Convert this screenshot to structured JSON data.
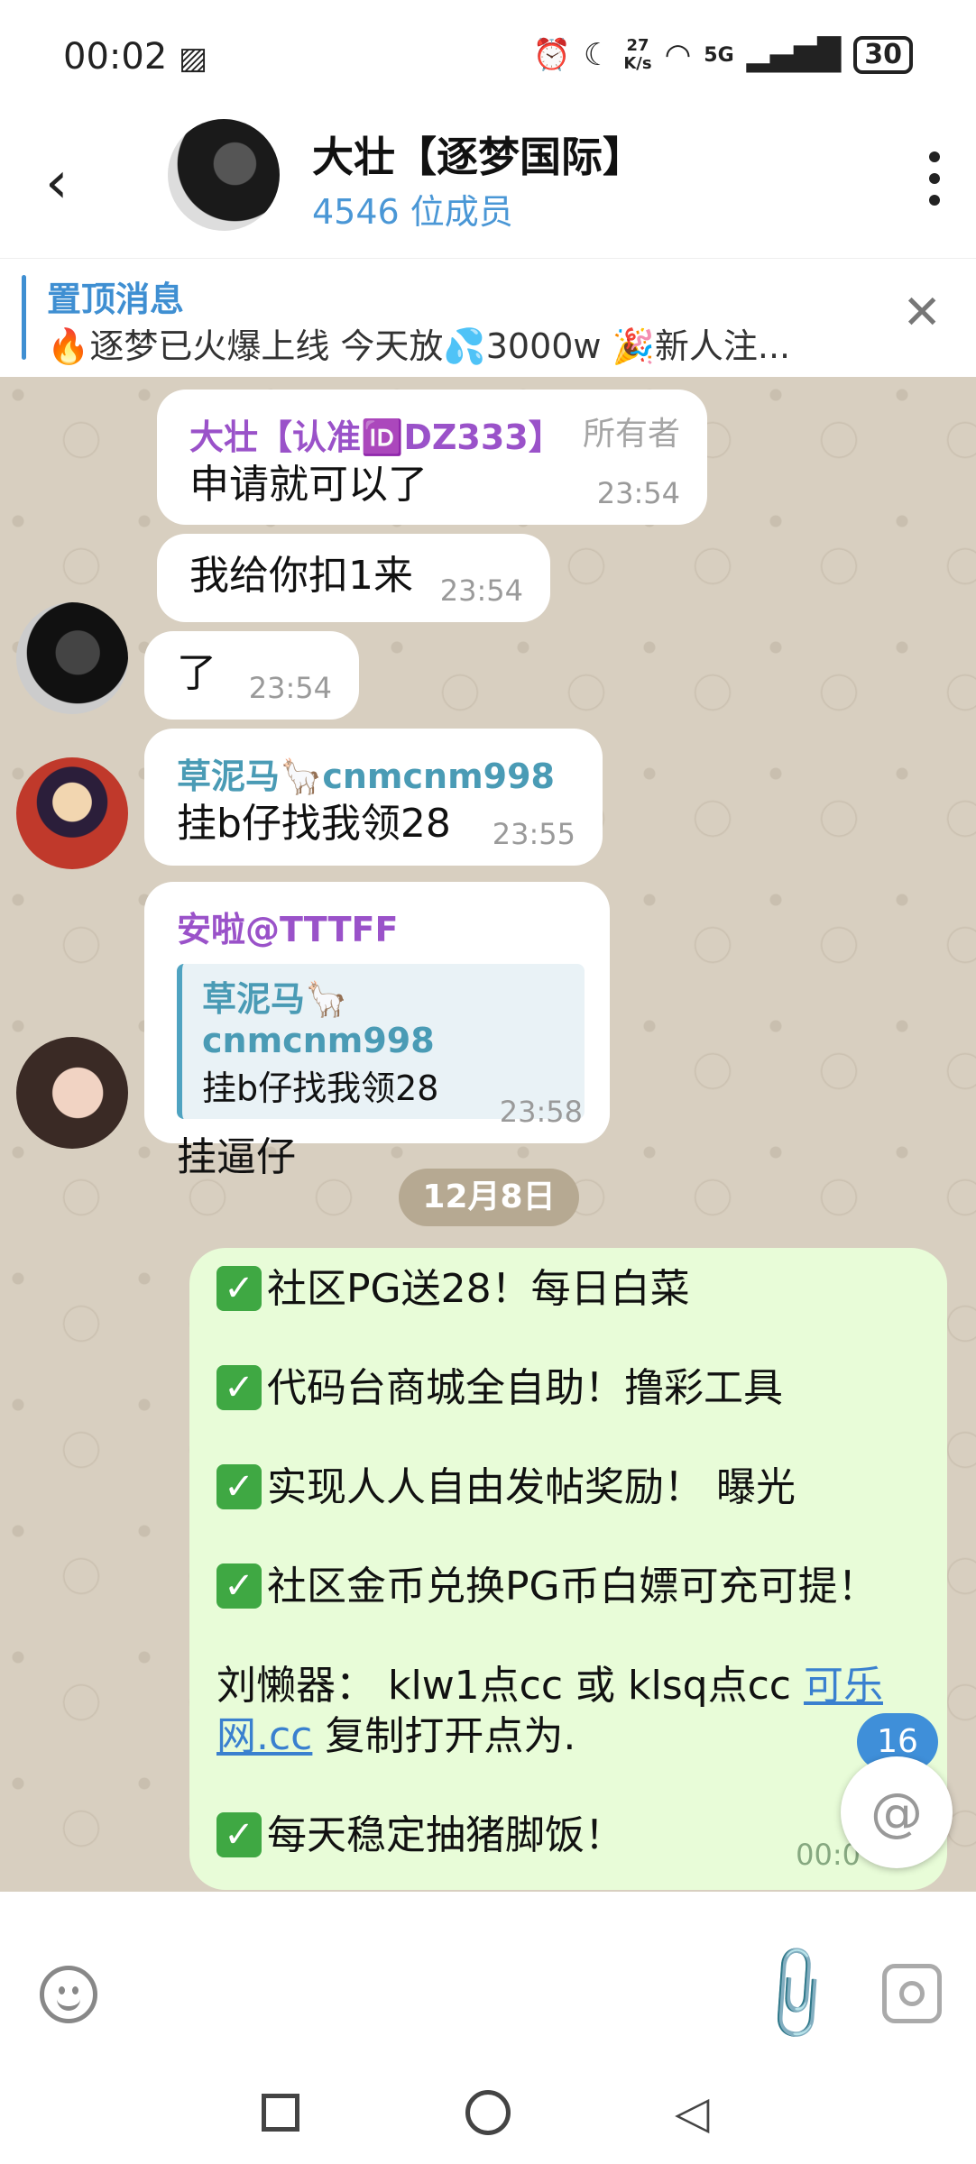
{
  "status_bar": {
    "time": "00:02",
    "gallery_icon": "▨",
    "speed_top": "27",
    "speed_bottom": "K/s",
    "network": "5G",
    "battery": "30"
  },
  "header": {
    "title": "大壮【逐梦国际】",
    "subtitle": "4546 位成员"
  },
  "pinned": {
    "label": "置顶消息",
    "text": "🔥逐梦已火爆上线 今天放💦3000w 🎉新人注..."
  },
  "messages": [
    {
      "sender": "大壮【认准🆔DZ333】",
      "role": "所有者",
      "text": "申请就可以了",
      "time": "23:54"
    },
    {
      "text": "我给你扣1来",
      "time": "23:54"
    },
    {
      "text": "了",
      "time": "23:54"
    },
    {
      "sender": "草泥马🦙cnmcnm998",
      "text": "挂b仔找我领28",
      "time": "23:55"
    },
    {
      "sender": "安啦@TTTFF",
      "quote_sender": "草泥马🦙cnmcnm998",
      "quote_text": "挂b仔找我领28",
      "text": "挂逼仔",
      "time": "23:58"
    }
  ],
  "date_pill": "12月8日",
  "outgoing": {
    "check_icon": "✓",
    "lines": [
      "社区PG送28！每日白菜",
      "代码台商城全自助！撸彩工具",
      "实现人人自由发帖奖励！ 曝光",
      "社区金币兑换PG币白嫖可充可提！"
    ],
    "para_prefix": "刘懒器： klw1点cc 或 klsq点cc ",
    "link_text": "可乐网.cc",
    "para_suffix": " 复制打开点为.",
    "last_line": "每天稳定抽猪脚饭！",
    "time": "00:0"
  },
  "unread_badge": "16",
  "mention_icon": "@",
  "colors": {
    "accent": "#3f8fd2",
    "sender_purple": "#9a52c9",
    "sender_teal": "#4a9bb5",
    "chat_bg": "#d8cfc0",
    "outgoing_bg": "#e8fcd8"
  }
}
